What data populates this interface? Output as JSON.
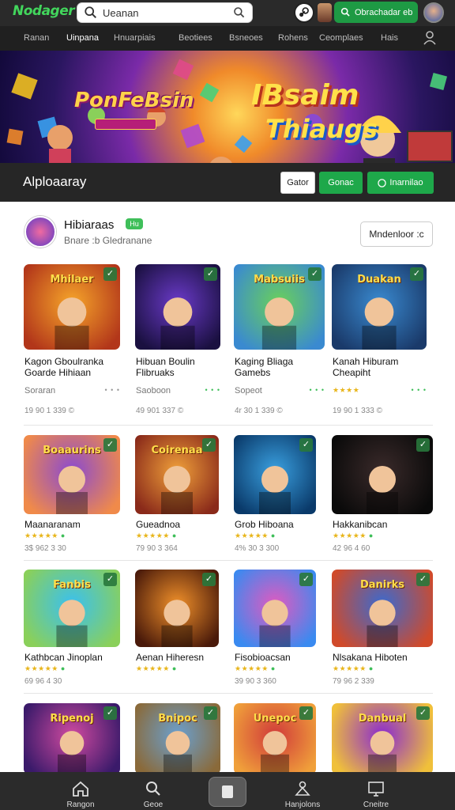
{
  "app": {
    "logo": "Nodager"
  },
  "search": {
    "value": "Ueanan"
  },
  "top": {
    "button_label": "Obrachadar eb"
  },
  "nav": {
    "items": [
      {
        "label": "Ranan"
      },
      {
        "label": "Uinpana"
      },
      {
        "label": "Hnuarpiais"
      },
      {
        "label": "Beotiees"
      },
      {
        "label": "Bsneoes"
      },
      {
        "label": "Rohens"
      },
      {
        "label": "Ceomplaes"
      },
      {
        "label": "Hais"
      }
    ]
  },
  "banner": {
    "left_title": "PonFeBsin",
    "right_title": "IBsaim",
    "right_subtitle": "Thiaugs"
  },
  "section": {
    "title": "Alploaaray",
    "btn1": "Gator",
    "btn2": "Gonac",
    "btn3": "Inarnilao"
  },
  "developer": {
    "name": "Hibiaraas",
    "badge": "Hu",
    "subtitle": "Bnare :b Gledranane",
    "button": "Mndenloor :c"
  },
  "games": [
    {
      "thumb_title": "Mhilaer",
      "name": "Kagon Gboulranka",
      "name2": "Goarde Hihiaan",
      "meta": "Soraran",
      "stats": "19 90 1 339 ©"
    },
    {
      "thumb_title": "",
      "name": "Hibuan Boulin",
      "name2": "Flibruaks",
      "meta": "Saoboon",
      "stats": "49 901 337 ©"
    },
    {
      "thumb_title": "Mabsuiis",
      "name": "Kaging Bliaga",
      "name2": "Gamebs",
      "meta": "Sopeot",
      "stats": "4r 30 1 339 ©"
    },
    {
      "thumb_title": "Duakan",
      "name": "Kanah Hiburam",
      "name2": "Cheapiht",
      "meta": "",
      "stats": "19 90 1 333 ©"
    },
    {
      "thumb_title": "Boaaurins",
      "name": "Maanaranam",
      "meta": "",
      "stats": "3$ 962 3 30"
    },
    {
      "thumb_title": "Coirenaa",
      "name": "Gueadnoa",
      "meta": "",
      "stats": "79 90 3 364"
    },
    {
      "thumb_title": "",
      "name": "Grob Hiboana",
      "meta": "",
      "stats": "4% 30 3 300"
    },
    {
      "thumb_title": "",
      "name": "Hakkanibcan",
      "meta": "",
      "stats": "42 96 4 60"
    },
    {
      "thumb_title": "Fanbis",
      "name": "Kathbcan Jinoplan",
      "meta": "",
      "stats": "69 96 4 30"
    },
    {
      "thumb_title": "",
      "name": "Aenan Hiheresn",
      "meta": "",
      "stats": ""
    },
    {
      "thumb_title": "",
      "name": "Fisobioacsan",
      "meta": "",
      "stats": "39 90 3 360"
    },
    {
      "thumb_title": "Danirks",
      "name": "Nlsakana Hiboten",
      "meta": "",
      "stats": "79 96 2 339"
    },
    {
      "thumb_title": "Ripenoj",
      "name": "",
      "meta": "",
      "stats": ""
    },
    {
      "thumb_title": "Bnipoc",
      "name": "",
      "meta": "",
      "stats": ""
    },
    {
      "thumb_title": "Unepoc",
      "name": "",
      "meta": "",
      "stats": ""
    },
    {
      "thumb_title": "Danbual",
      "name": "",
      "meta": "",
      "stats": ""
    }
  ],
  "bottom_nav": [
    {
      "label": "Rangon"
    },
    {
      "label": "Geoe"
    },
    {
      "label": ""
    },
    {
      "label": "Hanjolons"
    },
    {
      "label": "Cneitre"
    }
  ],
  "colors": {
    "green": "#1e9a44",
    "dark": "#262626",
    "gold": "#e8b51a"
  }
}
